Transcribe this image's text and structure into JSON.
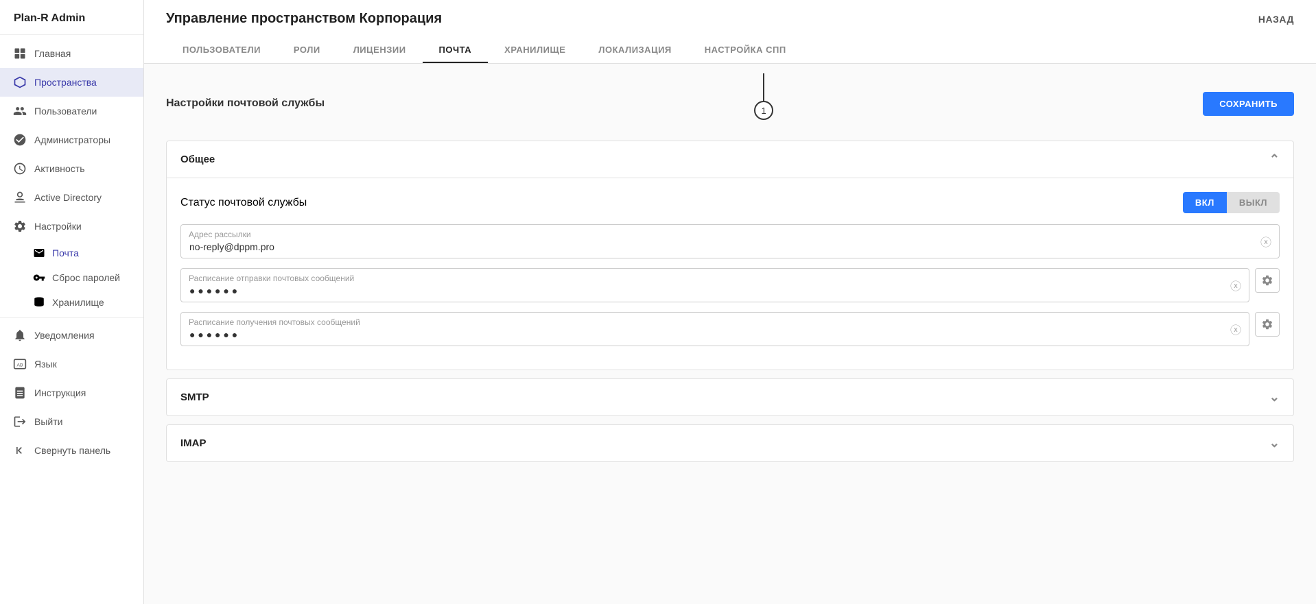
{
  "sidebar": {
    "logo": "Plan-R Admin",
    "items": [
      {
        "id": "main",
        "label": "Главная",
        "icon": "grid"
      },
      {
        "id": "spaces",
        "label": "Пространства",
        "icon": "cube",
        "active": true
      },
      {
        "id": "users",
        "label": "Пользователи",
        "icon": "users"
      },
      {
        "id": "admins",
        "label": "Администраторы",
        "icon": "admin"
      },
      {
        "id": "activity",
        "label": "Активность",
        "icon": "clock"
      },
      {
        "id": "active-directory",
        "label": "Active Directory",
        "icon": "ad"
      },
      {
        "id": "settings",
        "label": "Настройки",
        "icon": "gear"
      }
    ],
    "sub_items": [
      {
        "id": "mail",
        "label": "Почта",
        "icon": "mail",
        "active": true
      },
      {
        "id": "password-reset",
        "label": "Сброс паролей",
        "icon": "key"
      },
      {
        "id": "storage",
        "label": "Хранилище",
        "icon": "database"
      }
    ],
    "footer_items": [
      {
        "id": "notifications",
        "label": "Уведомления",
        "icon": "bell"
      },
      {
        "id": "language",
        "label": "Язык",
        "icon": "lang"
      },
      {
        "id": "manual",
        "label": "Инструкция",
        "icon": "book"
      },
      {
        "id": "logout",
        "label": "Выйти",
        "icon": "logout"
      },
      {
        "id": "collapse",
        "label": "Свернуть панель",
        "icon": "collapse"
      }
    ]
  },
  "header": {
    "title": "Управление пространством Корпорация",
    "back_label": "НАЗАД",
    "tabs": [
      {
        "id": "users",
        "label": "ПОЛЬЗОВАТЕЛИ"
      },
      {
        "id": "roles",
        "label": "РОЛИ"
      },
      {
        "id": "licenses",
        "label": "ЛИЦЕНЗИИ"
      },
      {
        "id": "mail",
        "label": "ПОЧТА",
        "active": true
      },
      {
        "id": "storage",
        "label": "ХРАНИЛИЩЕ"
      },
      {
        "id": "localization",
        "label": "ЛОКАЛИЗАЦИЯ"
      },
      {
        "id": "spp-settings",
        "label": "НАСТРОЙКА СПП"
      }
    ]
  },
  "content": {
    "section_title": "Настройки почтовой службы",
    "save_button": "СОХРАНИТЬ",
    "accordion_general": {
      "title": "Общее",
      "expanded": true,
      "mail_status_label": "Статус почтовой службы",
      "toggle_on": "ВКЛ",
      "toggle_off": "ВЫКЛ",
      "address_field": {
        "label": "Адрес рассылки",
        "value": "no-reply@dppm.pro"
      },
      "send_schedule_field": {
        "label": "Расписание отправки почтовых сообщений",
        "value": "● ● ● ● ● ●"
      },
      "receive_schedule_field": {
        "label": "Расписание получения почтовых сообщений",
        "value": "● ● ● ● ● ●"
      }
    },
    "accordion_smtp": {
      "title": "SMTP",
      "expanded": false
    },
    "accordion_imap": {
      "title": "IMAP",
      "expanded": false
    },
    "indicator_number": "1"
  }
}
